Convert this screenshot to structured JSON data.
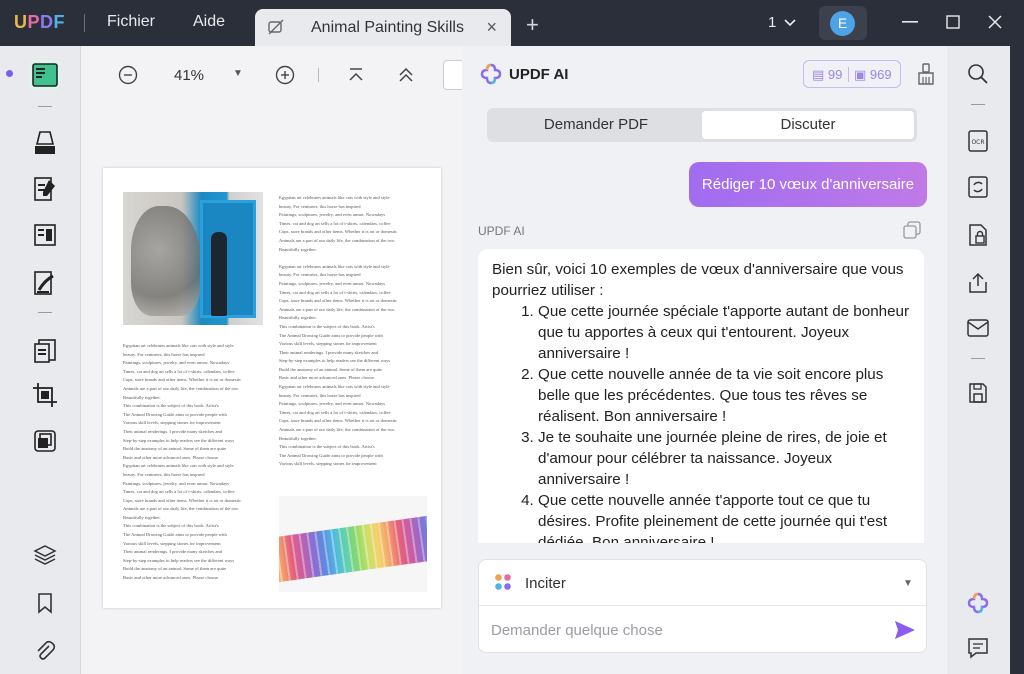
{
  "app": {
    "logo": "UPDF",
    "menu": [
      "Fichier",
      "Aide"
    ]
  },
  "tab": {
    "title": "Animal Painting Skills",
    "close": "×",
    "new": "+"
  },
  "window": {
    "page_selector": "1",
    "avatar_letter": "E",
    "controls": [
      "minimize",
      "maximize",
      "close"
    ]
  },
  "left_toolbar": {
    "icons": [
      "reader-icon",
      "comment-icon",
      "edit-pdf-icon",
      "form-icon",
      "sign-icon",
      "organize-pages-icon",
      "crop-icon",
      "convert-icon",
      "layers-icon",
      "bookmark-icon",
      "attachment-icon"
    ]
  },
  "viewer": {
    "zoom": "41%",
    "page": {
      "column_right_top": "Egyptian art celebrates animals like cats with style and style\nbeauty. For centuries, this horse has inspired\nPaintings, sculptures, jewelry, and even armor. Nowadays\nTimes, cat and dog art sells a lot of t-shirts, calendars, coffee\nCups, store brands and other items. Whether it is art or domestic\nAnimals are a part of our daily life, the combination of the two\nBeautifully together.\n\nEgyptian art celebrates animals like cats with style and style\nbeauty. For centuries, this horse has inspired\nPaintings, sculptures, jewelry, and even armor. Nowadays\nTimes, cat and dog art sells a lot of t-shirts, calendars, coffee\nCups, store brands and other items. Whether it is art or domestic\nAnimals are a part of our daily life, the combination of the two\nBeautifully together.\nThis combination is the subject of this book. Artist's\nThe Animal Drawing Guide aims to provide people with\nVarious skill levels, stepping stones for improvement\nTheir animal renderings. I provide many sketches and\nStep-by-step examples to help readers see the different ways\nBuild the anatomy of an animal. Some of them are quite\nBasic and other more advanced ones. Please choose\nEgyptian art celebrates animals like cats with style and style\nbeauty. For centuries, this horse has inspired\nPaintings, sculptures, jewelry, and even armor. Nowadays\nTimes, cat and dog art sells a lot of t-shirts, calendars, coffee\nCups, store brands and other items. Whether it is art or domestic\nAnimals are a part of our daily life, the combination of the two\nBeautifully together.\nThis combination is the subject of this book. Artist's\nThe Animal Drawing Guide aims to provide people with\nVarious skill levels, stepping stones for improvement",
      "column_left_bottom": "Egyptian art celebrates animals like cats with style and style\nbeauty. For centuries, this horse has inspired\nPaintings, sculptures, jewelry, and even armor. Nowadays\nTimes, cat and dog art sells a lot of t-shirts, calendars, coffee\nCups, store brands and other items. Whether it is art or domestic\nAnimals are a part of our daily life, the combination of the two\nBeautifully together.\nThis combination is the subject of this book. Artist's\nThe Animal Drawing Guide aims to provide people with\nVarious skill levels, stepping stones for improvement\nTheir animal renderings. I provide many sketches and\nStep-by-step examples to help readers see the different ways\nBuild the anatomy of an animal. Some of them are quite\nBasic and other more advanced ones. Please choose\nEgyptian art celebrates animals like cats with style and style\nbeauty. For centuries, this horse has inspired\nPaintings, sculptures, jewelry, and even armor. Nowadays\nTimes, cat and dog art sells a lot of t-shirts, calendars, coffee\nCups, store brands and other items. Whether it is art or domestic\nAnimals are a part of our daily life, the combination of the two\nBeautifully together.\nThis combination is the subject of this book. Artist's\nThe Animal Drawing Guide aims to provide people with\nVarious skill levels, stepping stones for improvement\nTheir animal renderings. I provide many sketches and\nStep-by-step examples to help readers see the different ways\nBuild the anatomy of an animal. Some of them are quite\nBasic and other more advanced ones. Please choose"
    }
  },
  "ai_panel": {
    "title": "UPDF AI",
    "credits_pdf": "99",
    "credits_chat": "969",
    "tabs": [
      "Demander PDF",
      "Discuter"
    ],
    "active_tab": "Discuter",
    "user_message": "Rédiger 10 vœux d'anniversaire",
    "bot_label": "UPDF AI",
    "bot_intro": "Bien sûr, voici 10 exemples de vœux d'anniversaire que vous pourriez utiliser :",
    "bot_items": [
      "Que cette journée spéciale t'apporte autant de bonheur que tu apportes à ceux qui t'entourent. Joyeux anniversaire !",
      "Que cette nouvelle année de ta vie soit encore plus belle que les précédentes. Que tous tes rêves se réalisent. Bon anniversaire !",
      "Je te souhaite une journée pleine de rires, de joie et d'amour pour célébrer ta naissance. Joyeux anniversaire !",
      "Que cette nouvelle année t'apporte tout ce que tu désires. Profite pleinement de cette journée qui t'est dédiée. Bon anniversaire !"
    ],
    "prompt_label": "Inciter",
    "input_placeholder": "Demander quelque chose"
  },
  "right_toolbar": {
    "icons": [
      "search-icon",
      "ocr-icon",
      "convert-icon",
      "protect-icon",
      "share-icon",
      "email-icon",
      "save-icon",
      "updf-ai-icon",
      "comment-list-icon"
    ]
  },
  "colors": {
    "accent": "#9b6cf0",
    "titlebar": "#2b2f3a",
    "panel": "#f0f1f4"
  }
}
